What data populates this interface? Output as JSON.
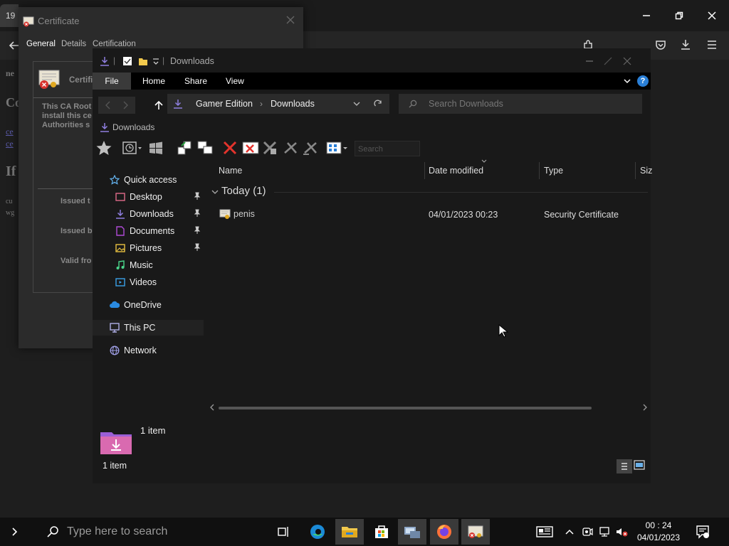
{
  "browser": {
    "tab_text": "19",
    "page_fragments": [
      "ne",
      "Co",
      "ce",
      "ce",
      "If",
      "cu",
      "wg"
    ]
  },
  "cert_dialog": {
    "title": "Certificate",
    "tabs": [
      "General",
      "Details",
      "Certification Path"
    ],
    "info_heading": "Certifi",
    "info_lines": [
      "This CA Root",
      "install this ce",
      "Authorities s"
    ],
    "labels": [
      "Issued t",
      "Issued b",
      "Valid fro"
    ]
  },
  "explorer": {
    "title": "Downloads",
    "ribbon_tabs": [
      "File",
      "Home",
      "Share",
      "View"
    ],
    "address": {
      "root": "Gamer Edition",
      "separator": "›",
      "current": "Downloads"
    },
    "search_placeholder": "Search Downloads",
    "breadcrumb_label": "Downloads",
    "toolbar_search_placeholder": "Search",
    "nav": {
      "quick_access": "Quick access",
      "items": [
        "Desktop",
        "Downloads",
        "Documents",
        "Pictures",
        "Music",
        "Videos"
      ],
      "onedrive": "OneDrive",
      "this_pc": "This PC",
      "network": "Network"
    },
    "columns": [
      "Name",
      "Date modified",
      "Type",
      "Siz"
    ],
    "group": "Today (1)",
    "files": [
      {
        "name": "penis",
        "date": "04/01/2023 00:23",
        "type": "Security Certificate"
      }
    ],
    "status_count": "1 item",
    "status_label": "1 item"
  },
  "taskbar": {
    "search_placeholder": "Type here to search",
    "time": "00 : 24",
    "date": "04/01/2023"
  },
  "colors": {
    "accent": "#0078d4",
    "help": "#2a7fd6"
  }
}
